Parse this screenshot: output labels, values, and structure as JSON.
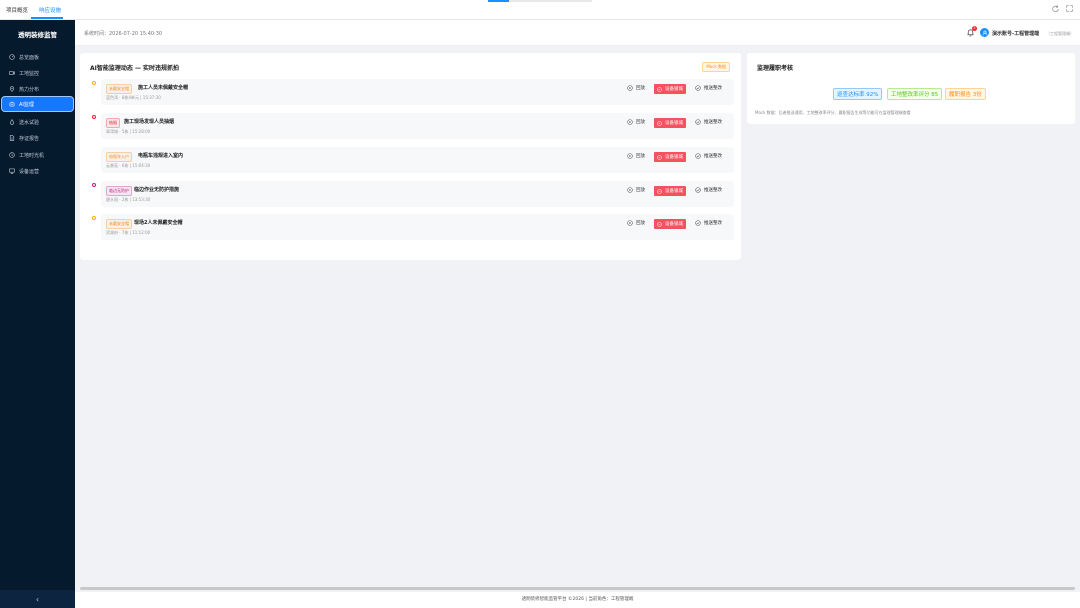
{
  "tabs": [
    {
      "label": "项目概览",
      "active": false
    },
    {
      "label": "响应设施",
      "active": true
    }
  ],
  "toolbar": {
    "refresh_icon": "refresh-icon",
    "fullscreen_icon": "fullscreen-icon"
  },
  "sidebar": {
    "title": "透明装修监管",
    "items": [
      {
        "label": "总览面板",
        "icon": "dashboard-icon",
        "active": false
      },
      {
        "label": "工地监控",
        "icon": "camera-icon",
        "active": false
      },
      {
        "label": "热力分布",
        "icon": "location-icon",
        "active": false
      },
      {
        "label": "AI监理",
        "icon": "robot-icon",
        "active": true
      },
      {
        "label": "送水试验",
        "icon": "water-icon",
        "active": false
      },
      {
        "label": "存证报告",
        "icon": "document-icon",
        "active": false
      },
      {
        "label": "工地时光机",
        "icon": "clock-icon",
        "active": false
      },
      {
        "label": "设备运营",
        "icon": "monitor-icon",
        "active": false
      }
    ],
    "collapse_label": "‹"
  },
  "header": {
    "system_time": "系统时间：2026-07-20 15:40:30",
    "notification_count": "5",
    "user_name": "演示账号-工程管理端",
    "user_role": "（工程管理端）"
  },
  "ai_panel": {
    "title": "AI智能监理动态 — 实时违规抓拍",
    "mock_tag": "Mock 数据",
    "actions": {
      "playback": "回放",
      "lock": "设备锁城",
      "rectify": "推送整改"
    },
    "alerts": [
      {
        "tag": "未戴安全帽",
        "tag_color": "#fa8c16",
        "dot_color": "#faad14",
        "title": "施工人员未佩戴安全帽",
        "meta": "蓝色湾 · 8栋4单元 | 15:37:30"
      },
      {
        "tag": "抽烟",
        "tag_color": "#f5222d",
        "dot_color": "#f5222d",
        "title": "施工现场发现人员抽烟",
        "meta": "翠湾城 · 5栋 | 15:28:00"
      },
      {
        "tag": "电瓶车入户",
        "tag_color": "#fa8c16",
        "dot_color": "",
        "title": "电瓶车违规进入室内",
        "meta": "云景苑 · 6栋 | 15:04:30"
      },
      {
        "tag": "临边无防护",
        "tag_color": "#c41d7f",
        "dot_color": "#c41d7f",
        "title": "临边作业无防护措施",
        "meta": "碧水园 · 2栋 | 13:53:30"
      },
      {
        "tag": "未戴安全帽",
        "tag_color": "#fa8c16",
        "dot_color": "#faad14",
        "title": "现场2人未佩戴安全帽",
        "meta": "滨湖府 · 7栋 | 11:12:00"
      }
    ]
  },
  "supervision_panel": {
    "title": "监理履职考核",
    "metrics": [
      {
        "label": "巡查达标率 92%",
        "color": "#1890ff",
        "bg": "#e6f4ff"
      },
      {
        "label": "工地整改率评分 85",
        "color": "#52c41a",
        "bg": "#f6ffed"
      },
      {
        "label": "履职报告 3份",
        "color": "#fa8c16",
        "bg": "#fff7e6"
      }
    ],
    "note": "Mock 数据：后者推送通用、工地整改率评分、履职报告生成等功能可在监理管理端查看"
  },
  "footer": {
    "text": "透明装修智能监管平台 ©2026 | 当前角色：工程管理端"
  }
}
